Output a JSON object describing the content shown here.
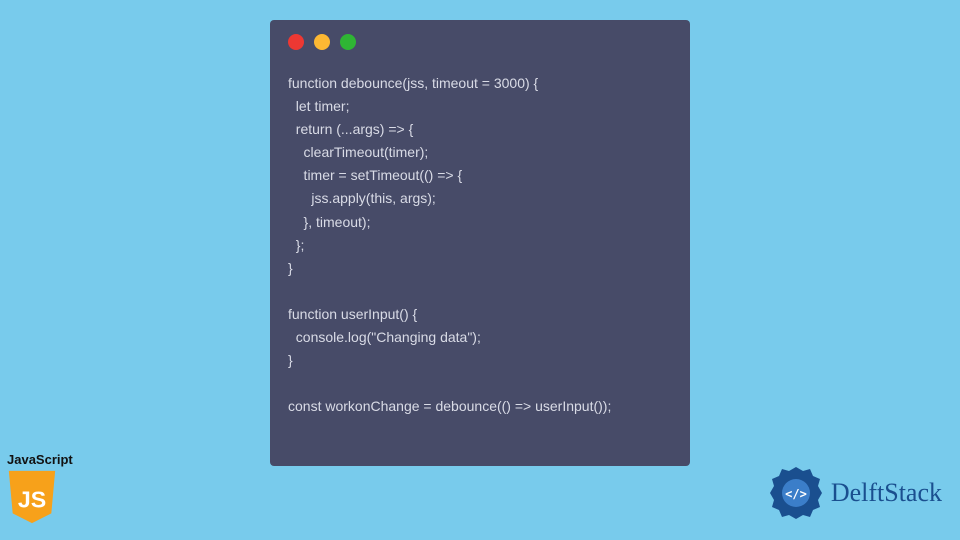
{
  "code": {
    "lines": "function debounce(jss, timeout = 3000) {\n  let timer;\n  return (...args) => {\n    clearTimeout(timer);\n    timer = setTimeout(() => {\n      jss.apply(this, args);\n    }, timeout);\n  };\n}\n\nfunction userInput() {\n  console.log(\"Changing data\");\n}\n\nconst workonChange = debounce(() => userInput());"
  },
  "js_badge": {
    "label": "JavaScript",
    "shield_text": "JS"
  },
  "brand": {
    "name": "DelftStack"
  },
  "colors": {
    "bg": "#78cbec",
    "window": "#474b68",
    "code_text": "#d9dbe6",
    "js_yellow": "#f7a11a",
    "brand_blue": "#1a4f8f"
  }
}
